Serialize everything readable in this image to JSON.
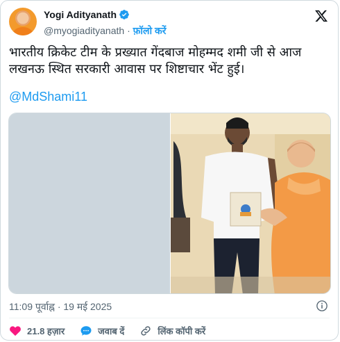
{
  "author": {
    "name": "Yogi Adityanath",
    "handle": "@myogiadityanath",
    "separator": "·",
    "follow_label": "फ़ॉलो करें"
  },
  "tweet": {
    "text": "भारतीय क्रिकेट टीम के प्रख्यात गेंदबाज मोहम्मद शमी जी से आज लखनऊ स्थित सरकारी आवास पर शिष्टाचार भेंट हुई।",
    "mention": "@MdShami11",
    "media_count": 2,
    "timestamp": "11:09 पूर्वाह्न · 19 मई 2025"
  },
  "actions": {
    "like_count": "21.8 हज़ार",
    "reply_label": "जवाब दें",
    "copy_link_label": "लिंक कॉपी करें"
  },
  "colors": {
    "accent": "#1d9bf0",
    "like": "#f91880",
    "muted": "#536471",
    "border": "#cfd9de"
  },
  "icons": {
    "logo": "x-logo-icon",
    "verified": "verified-badge-icon",
    "info": "info-icon",
    "like": "heart-icon",
    "reply": "speech-bubble-icon",
    "link": "link-icon"
  }
}
